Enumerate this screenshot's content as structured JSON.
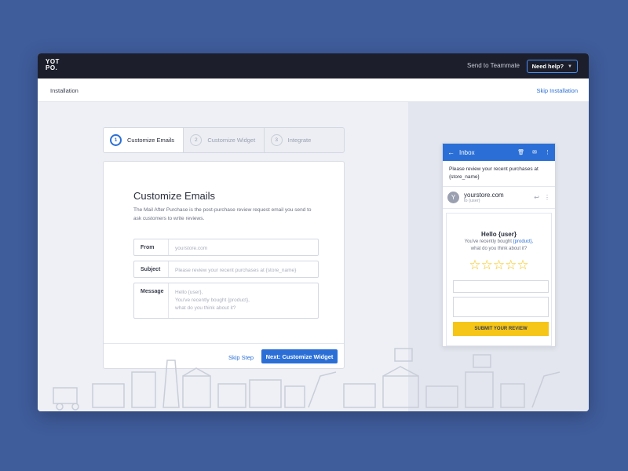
{
  "topbar": {
    "logo_line1": "YOT",
    "logo_line2": "PO.",
    "send_to_teammate": "Send to Teammate",
    "need_help": "Need help?"
  },
  "subbar": {
    "title": "Installation",
    "skip_installation": "Skip Installation"
  },
  "stepper": {
    "steps": [
      {
        "num": "1",
        "label": "Customize Emails"
      },
      {
        "num": "2",
        "label": "Customize Widget"
      },
      {
        "num": "3",
        "label": "Integrate"
      }
    ]
  },
  "card": {
    "title": "Customize Emails",
    "description": "The Mail After Purchase is the post-purchase review request email you send to ask customers to write reviews.",
    "from_label": "From",
    "from_placeholder": "yourstore.com",
    "subject_label": "Subject",
    "subject_placeholder": "Please review your recent purchases at {store_name}",
    "message_label": "Message",
    "message_line1": "Hello {user},",
    "message_line2": "You've recently bought {product},",
    "message_line3": "what do you think about it?",
    "skip_step": "Skip Step",
    "next": "Next: Customize Widget"
  },
  "preview": {
    "inbox": "Inbox",
    "subject_line": "Please review your recent purchases at {store_name}",
    "avatar_letter": "Y",
    "sender_name": "yourstore.com",
    "sender_to": "to {user}",
    "hello": "Hello {user}",
    "line1_prefix": "You've recently bought",
    "line1_product": "{product},",
    "line2": "what do you think about it?",
    "submit": "SUBMIT YOUR REVIEW",
    "accent": "#2b6fd6",
    "star_color": "#f5c518"
  }
}
